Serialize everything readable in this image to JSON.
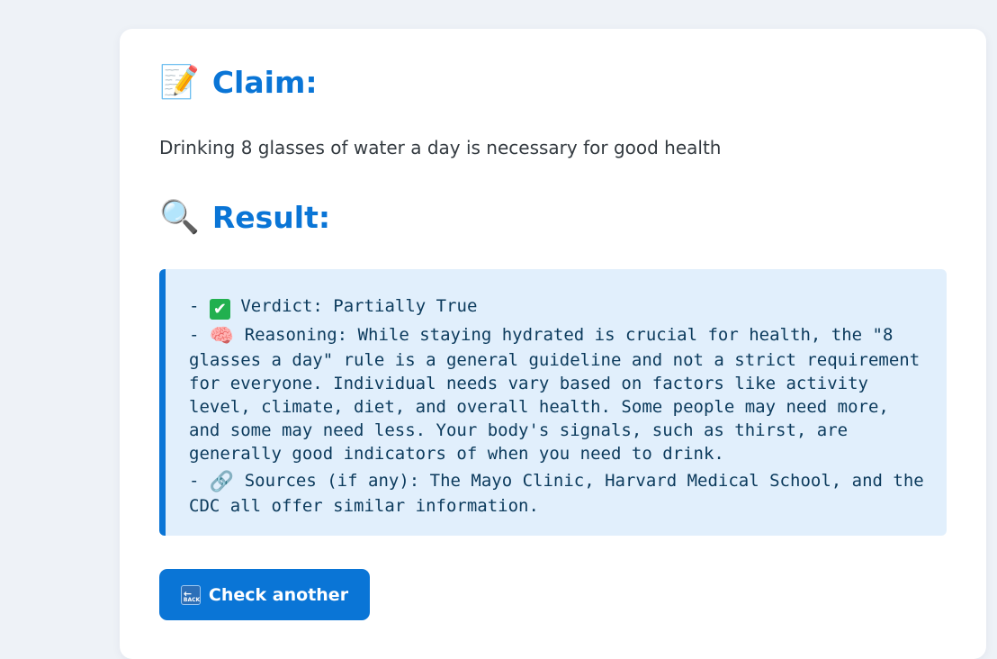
{
  "claim": {
    "heading_icon": "memo-icon",
    "heading_emoji": "📝",
    "heading": "Claim:",
    "text": "Drinking 8 glasses of water a day is necessary for good health"
  },
  "result": {
    "heading_icon": "magnifying-glass-icon",
    "heading_emoji": "🔍",
    "heading": "Result:",
    "verdict_prefix": "- ",
    "verdict_icon": "check-mark-icon",
    "verdict_glyph": "✔",
    "verdict": " Verdict: Partially True",
    "reasoning_prefix": "- ",
    "reasoning_icon": "brain-icon",
    "reasoning_emoji": "🧠",
    "reasoning": " Reasoning: While staying hydrated is crucial for health, the \"8 glasses a day\" rule is a general guideline and not a strict requirement for everyone. Individual needs vary based on factors like activity level, climate, diet, and overall health. Some people may need more, and some may need less. Your body's signals, such as thirst, are generally good indicators of when you need to drink.",
    "sources_prefix": "- ",
    "sources_icon": "link-icon",
    "sources_emoji": "🔗",
    "sources": " Sources (if any): The Mayo Clinic, Harvard Medical School, and the CDC all offer similar information."
  },
  "actions": {
    "back_icon": "back-arrow-icon",
    "back_icon_arrow": "←",
    "back_icon_word": "BACK",
    "check_another_label": "Check another"
  },
  "colors": {
    "accent": "#0a75d6",
    "result_background": "#e1effc",
    "page_background": "#eef2f7"
  }
}
